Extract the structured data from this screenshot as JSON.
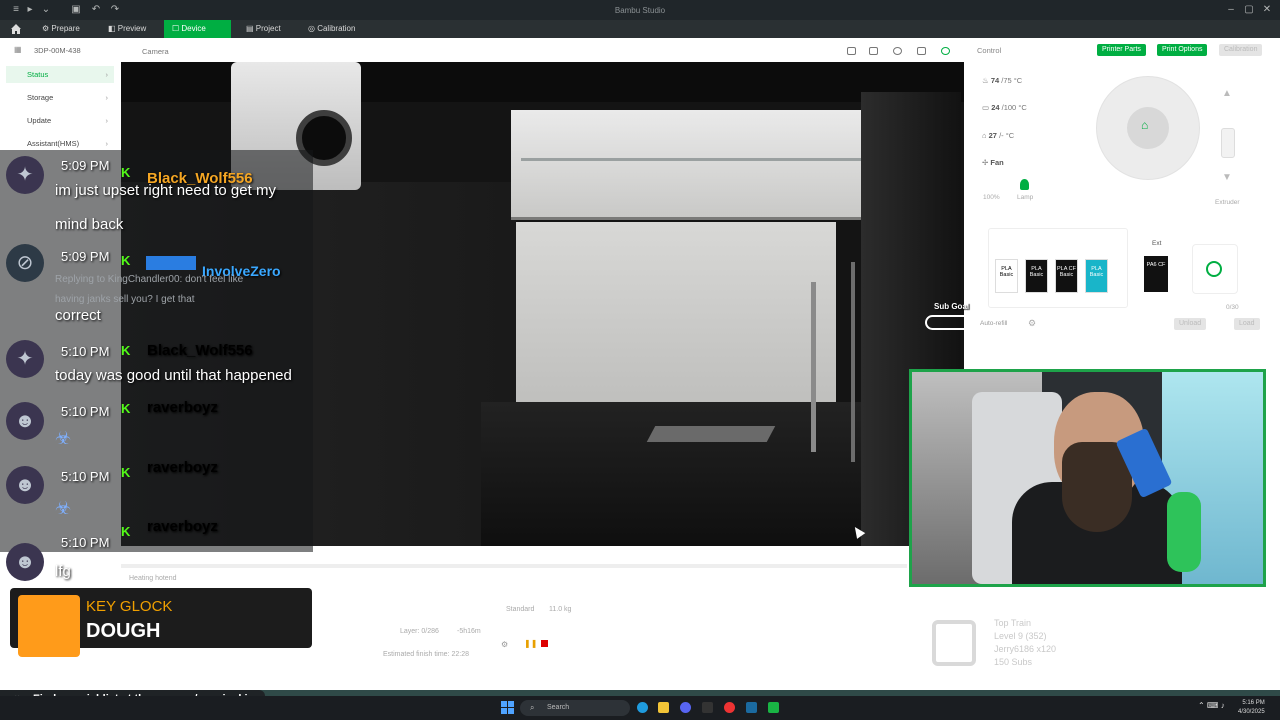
{
  "titlebar": {
    "title": "Bambu Studio",
    "controls": [
      "–",
      "▢",
      "✕"
    ]
  },
  "nav": {
    "tabs": [
      {
        "label": "Prepare"
      },
      {
        "label": "Preview"
      },
      {
        "label": "Device"
      },
      {
        "label": "Project"
      },
      {
        "label": "Calibration"
      }
    ],
    "active": "Device"
  },
  "sidebar": {
    "printer": "3DP-00M-438",
    "items": [
      {
        "label": "Status"
      },
      {
        "label": "Storage"
      },
      {
        "label": "Update"
      },
      {
        "label": "Assistant(HMS)"
      }
    ]
  },
  "camera": {
    "label": "Camera"
  },
  "control": {
    "title": "Control",
    "buttons": [
      "Printer Parts",
      "Print Options",
      "Calibration"
    ],
    "temps": [
      {
        "cur": "74",
        "target": "/75",
        "unit": "°C"
      },
      {
        "cur": "24",
        "target": "/100",
        "unit": "°C"
      },
      {
        "cur": "27",
        "target": "/-",
        "unit": "°C"
      }
    ],
    "fan_label": "Fan",
    "fan_value": "100%",
    "lamp_label": "Lamp",
    "extruder_label": "Extruder",
    "ext_label": "Ext",
    "slots": [
      {
        "type": "PLA",
        "sub": "Basic"
      },
      {
        "type": "PLA",
        "sub": "Basic"
      },
      {
        "type": "PLA CF",
        "sub": "Basic"
      },
      {
        "type": "PLA",
        "sub": "Basic"
      }
    ],
    "ext_slot": {
      "type": "PA6 CF",
      "sub": ""
    },
    "auto_refill": "Auto-refill",
    "load": "Unload",
    "unload": "Load",
    "counter": "0/30"
  },
  "status": {
    "layer": "Layer: 0/286",
    "remaining": "-5h16m",
    "finish": "Estimated finish time: 22:28",
    "speed": "Standard",
    "weight": "11.0 kg",
    "task": "Heating hotend"
  },
  "chat": [
    {
      "time": "5:09 PM",
      "user": "Black_Wolf556",
      "color": "#f5a623",
      "text": "im just upset right need to get my",
      "text2": "mind back"
    },
    {
      "time": "5:09 PM",
      "user": "InvolveZero",
      "color": "#3aa8ff",
      "reply": "Replying to KingChandler00: don't feel like",
      "reply2": "having janks sell you? I get that",
      "text": "correct"
    },
    {
      "time": "5:10 PM",
      "user": "Black_Wolf556",
      "color": "#f5a623",
      "text": "today was good until that happened"
    },
    {
      "time": "5:10 PM",
      "user": "raverboyz",
      "color": "#f5a623",
      "text": ""
    },
    {
      "time": "5:10 PM",
      "user": "raverboyz",
      "color": "#f5a623",
      "text": ""
    },
    {
      "time": "5:10 PM",
      "user": "raverboyz",
      "color": "#f5a623",
      "text": "lfg"
    }
  ],
  "overlay": {
    "subgoal": "Sub Goal",
    "song_artist": "KEY GLOCK",
    "song_title": "DOUGH",
    "wishlist": "Find my wishlist at throne.com/gzusjankins",
    "train": {
      "title": "Top Train",
      "level": "Level 9  (352)",
      "record": "Jerry6186 x120",
      "subs": "150 Subs"
    }
  },
  "taskbar": {
    "search": "Search",
    "time": "5:16 PM",
    "date": "4/30/2025"
  }
}
